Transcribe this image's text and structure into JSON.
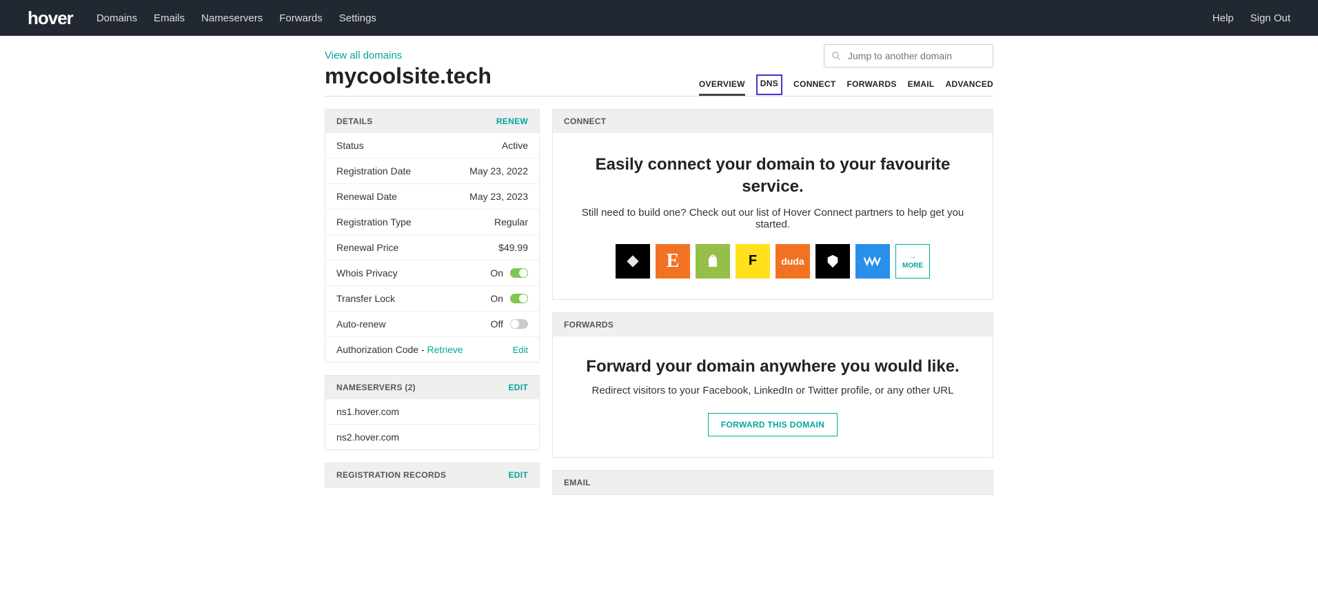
{
  "nav": {
    "logo": "hover",
    "links": [
      "Domains",
      "Emails",
      "Nameservers",
      "Forwards",
      "Settings"
    ],
    "right": [
      "Help",
      "Sign Out"
    ]
  },
  "header": {
    "view_all": "View all domains",
    "domain": "mycoolsite.tech",
    "search_placeholder": "Jump to another domain"
  },
  "tabs": [
    {
      "label": "OVERVIEW",
      "active": true
    },
    {
      "label": "DNS",
      "highlighted": true
    },
    {
      "label": "CONNECT"
    },
    {
      "label": "FORWARDS"
    },
    {
      "label": "EMAIL"
    },
    {
      "label": "ADVANCED"
    }
  ],
  "details": {
    "title": "DETAILS",
    "action": "RENEW",
    "rows": [
      {
        "label": "Status",
        "value": "Active"
      },
      {
        "label": "Registration Date",
        "value": "May 23, 2022"
      },
      {
        "label": "Renewal Date",
        "value": "May 23, 2023"
      },
      {
        "label": "Registration Type",
        "value": "Regular"
      },
      {
        "label": "Renewal Price",
        "value": "$49.99"
      }
    ],
    "toggles": [
      {
        "label": "Whois Privacy",
        "state_label": "On",
        "on": true
      },
      {
        "label": "Transfer Lock",
        "state_label": "On",
        "on": true
      },
      {
        "label": "Auto-renew",
        "state_label": "Off",
        "on": false
      }
    ],
    "auth": {
      "label": "Authorization Code - ",
      "link": "Retrieve",
      "edit": "Edit"
    }
  },
  "nameservers": {
    "title": "NAMESERVERS (2)",
    "action": "EDIT",
    "items": [
      "ns1.hover.com",
      "ns2.hover.com"
    ]
  },
  "registration": {
    "title": "REGISTRATION RECORDS",
    "action": "EDIT"
  },
  "connect": {
    "title": "CONNECT",
    "headline": "Easily connect your domain to your favourite service.",
    "sub": "Still need to build one? Check out our list of Hover Connect partners to help get you started.",
    "services": [
      {
        "name": "squarespace",
        "glyph": "▨"
      },
      {
        "name": "etsy",
        "glyph": "E"
      },
      {
        "name": "shopify",
        "glyph": "🛍"
      },
      {
        "name": "flywheel",
        "glyph": "F"
      },
      {
        "name": "duda",
        "glyph": "duda"
      },
      {
        "name": "bigcartel",
        "glyph": "◆"
      },
      {
        "name": "weebly",
        "glyph": "W"
      }
    ],
    "more": "MORE"
  },
  "forwards": {
    "title": "FORWARDS",
    "headline": "Forward your domain anywhere you would like.",
    "sub": "Redirect visitors to your Facebook, LinkedIn or Twitter profile, or any other URL",
    "button": "FORWARD THIS DOMAIN"
  },
  "email": {
    "title": "EMAIL"
  }
}
